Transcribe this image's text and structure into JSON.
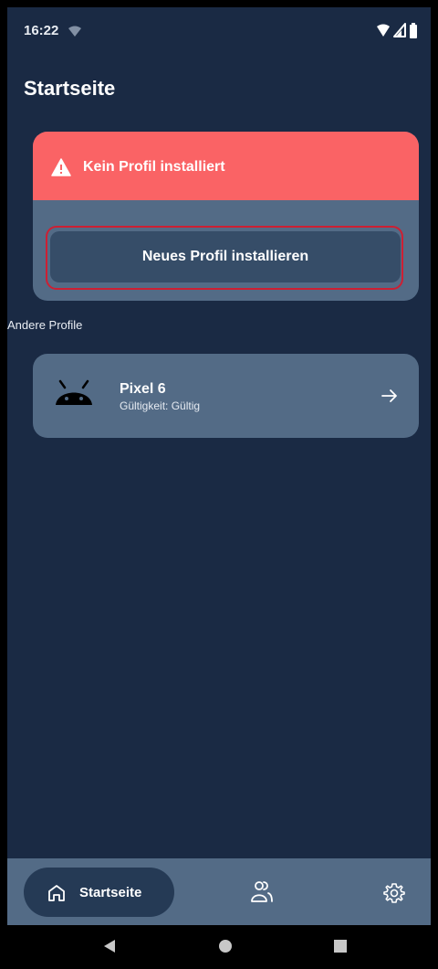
{
  "status_bar": {
    "time": "16:22"
  },
  "header": {
    "title": "Startseite"
  },
  "warning_card": {
    "title": "Kein Profil installiert",
    "install_button_label": "Neues Profil installieren"
  },
  "other_profiles": {
    "section_label": "Andere Profile",
    "items": [
      {
        "name": "Pixel 6",
        "validity": "Gültigkeit: Gültig"
      }
    ]
  },
  "bottom_nav": {
    "home_label": "Startseite"
  },
  "icons": [
    "wifi-icon",
    "signal-icon",
    "battery-icon",
    "warning-icon",
    "android-icon",
    "arrow-right-icon",
    "home-icon",
    "profiles-icon",
    "settings-icon",
    "back-icon",
    "home-circle-icon",
    "recent-apps-icon"
  ],
  "colors": {
    "background": "#1a2a44",
    "card": "#536b86",
    "warning": "#fa6365",
    "button": "#364d68",
    "highlight_border": "#cd1f33"
  }
}
